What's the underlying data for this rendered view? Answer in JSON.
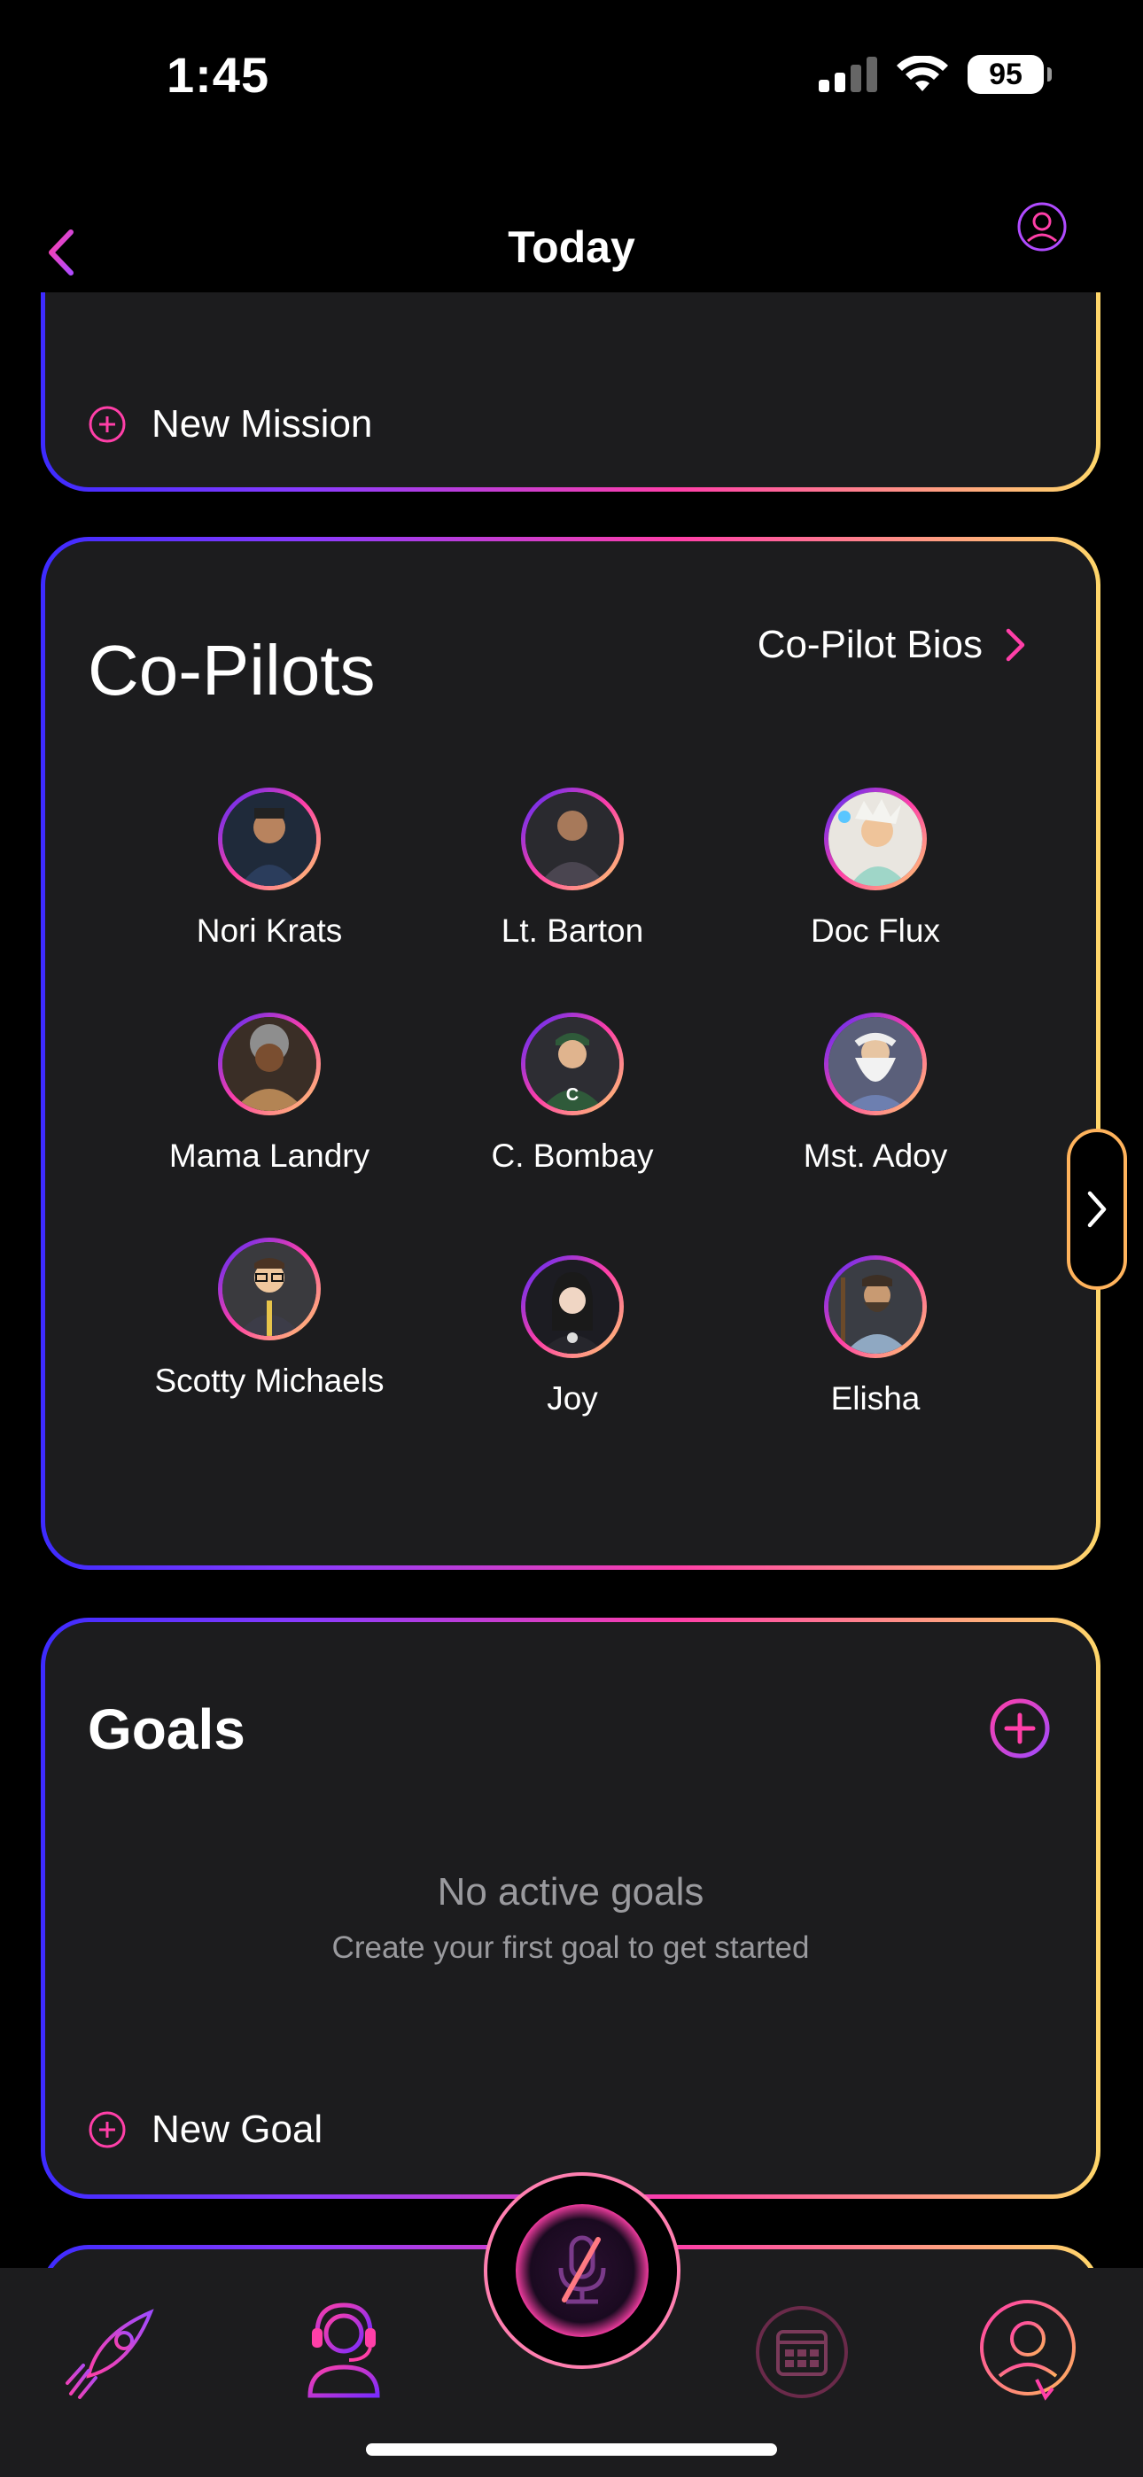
{
  "status": {
    "time": "1:45",
    "battery": "95"
  },
  "nav": {
    "title": "Today"
  },
  "mission_card": {
    "new_label": "New Mission"
  },
  "copilots": {
    "title": "Co-Pilots",
    "bios_link": "Co-Pilot Bios",
    "people": [
      {
        "name": "Nori Krats"
      },
      {
        "name": "Lt. Barton"
      },
      {
        "name": "Doc Flux"
      },
      {
        "name": "Mama Landry"
      },
      {
        "name": "C. Bombay"
      },
      {
        "name": "Mst. Adoy"
      },
      {
        "name": "Scotty Michaels"
      },
      {
        "name": "Joy"
      },
      {
        "name": "Elisha"
      }
    ]
  },
  "goals": {
    "title": "Goals",
    "empty_title": "No active goals",
    "empty_subtitle": "Create your first goal to get started",
    "new_label": "New Goal"
  },
  "colors": {
    "accent_pink": "#ff3fa8",
    "accent_purple": "#6a2bff",
    "accent_gold": "#ffd76a",
    "card_bg": "#1c1c1e"
  },
  "icons": [
    "back-chevron-icon",
    "profile-menu-icon",
    "rocket-icon",
    "headset-user-icon",
    "mic-off-icon",
    "calendar-icon",
    "support-agent-icon"
  ]
}
